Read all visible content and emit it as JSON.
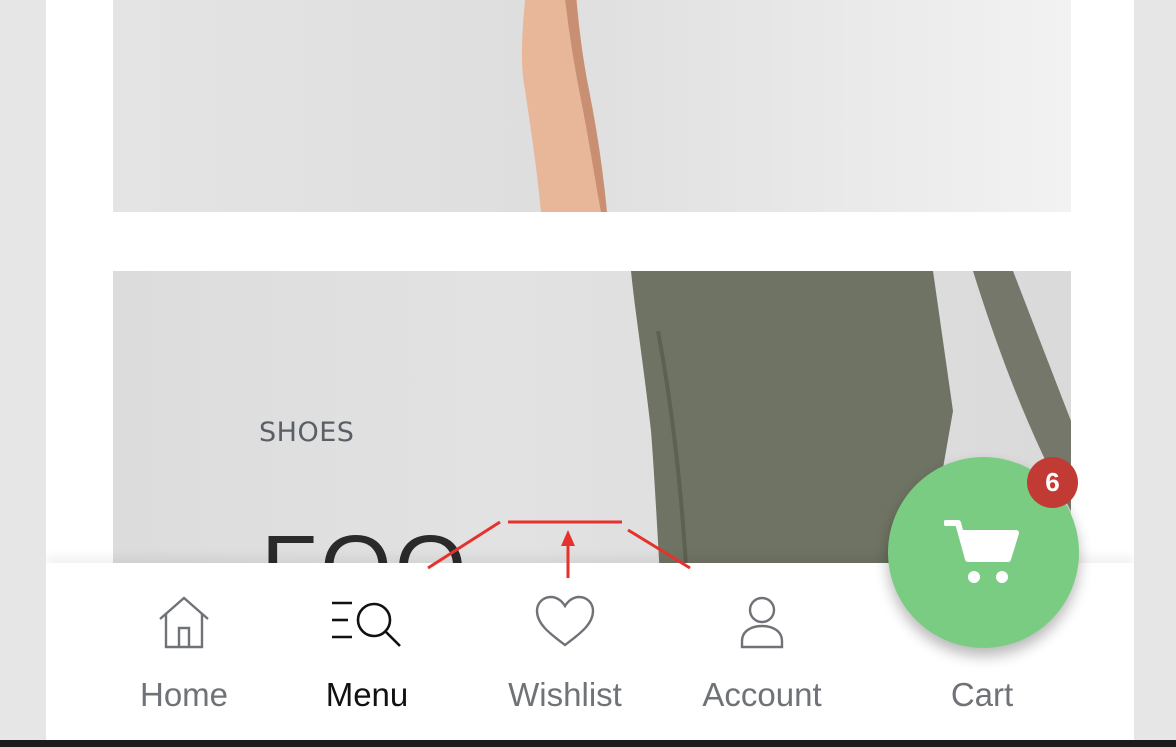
{
  "banner_secondary": {
    "category": "SHOES",
    "headline_partial": "FOO"
  },
  "bottom_nav": {
    "items": [
      {
        "label": "Home",
        "icon": "home-icon",
        "active": false
      },
      {
        "label": "Menu",
        "icon": "menu-search-icon",
        "active": true
      },
      {
        "label": "Wishlist",
        "icon": "heart-icon",
        "active": false
      },
      {
        "label": "Account",
        "icon": "user-icon",
        "active": false
      }
    ],
    "cart": {
      "label": "Cart",
      "count": "6",
      "icon": "cart-icon"
    }
  },
  "colors": {
    "cart_fab": "#7acc83",
    "cart_badge": "#c23a34",
    "annotation": "#e5322d",
    "nav_text": "#6f7378",
    "nav_active": "#111111"
  }
}
